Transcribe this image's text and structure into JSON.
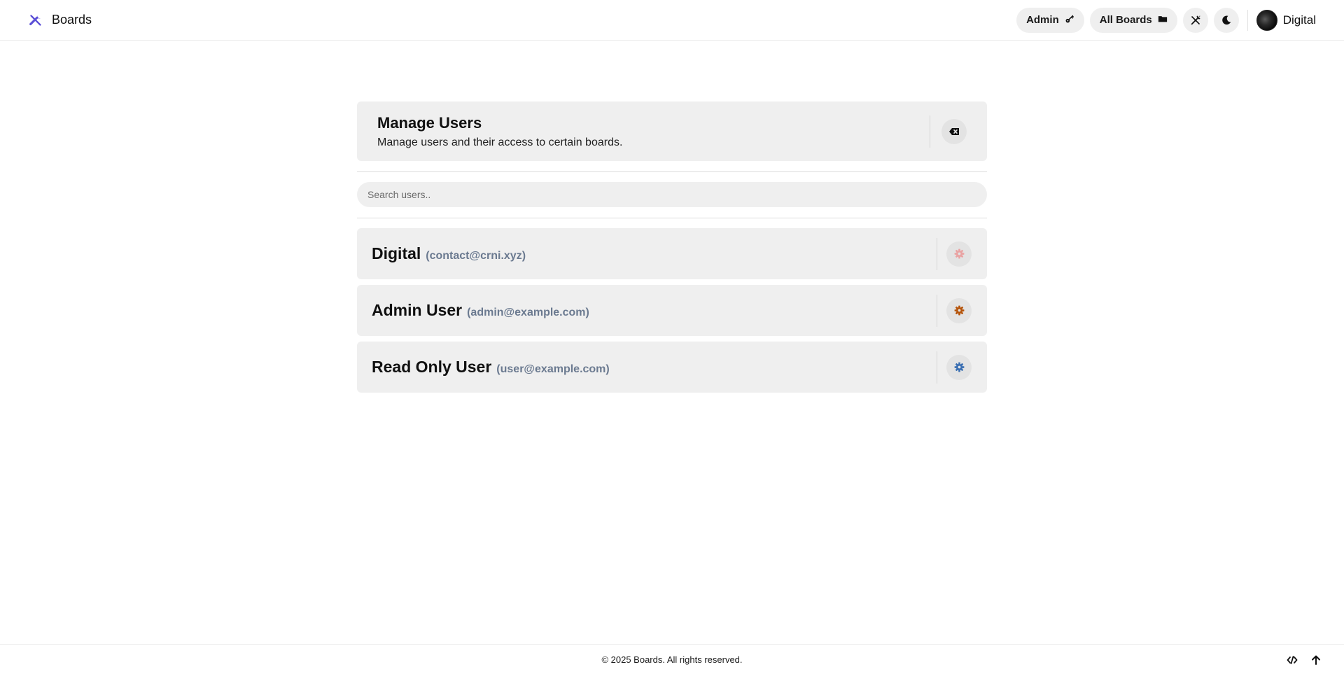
{
  "brand": {
    "name": "Boards",
    "logo_icon": "tools-icon",
    "logo_color": "#5b4fd6"
  },
  "nav": {
    "admin_label": "Admin",
    "admin_icon": "key-icon",
    "all_boards_label": "All Boards",
    "all_boards_icon": "folder-icon",
    "hide_icon": "crossed-tools-icon",
    "theme_icon": "moon-icon",
    "user_name": "Digital"
  },
  "manage": {
    "title": "Manage Users",
    "subtitle": "Manage users and their access to certain boards.",
    "close_icon": "backspace-icon"
  },
  "search": {
    "placeholder": "Search users..",
    "value": ""
  },
  "users": [
    {
      "name": "Digital",
      "email": "(contact@crni.xyz)",
      "settings_icon": "gear-icon",
      "icon_color": "#e9a3a3"
    },
    {
      "name": "Admin User",
      "email": "(admin@example.com)",
      "settings_icon": "gear-icon",
      "icon_color": "#b5540b"
    },
    {
      "name": "Read Only User",
      "email": "(user@example.com)",
      "settings_icon": "gear-icon",
      "icon_color": "#3b6fb2"
    }
  ],
  "footer": {
    "text": "© 2025 Boards. All rights reserved.",
    "code_icon": "code-icon",
    "up_icon": "arrow-up-icon"
  }
}
